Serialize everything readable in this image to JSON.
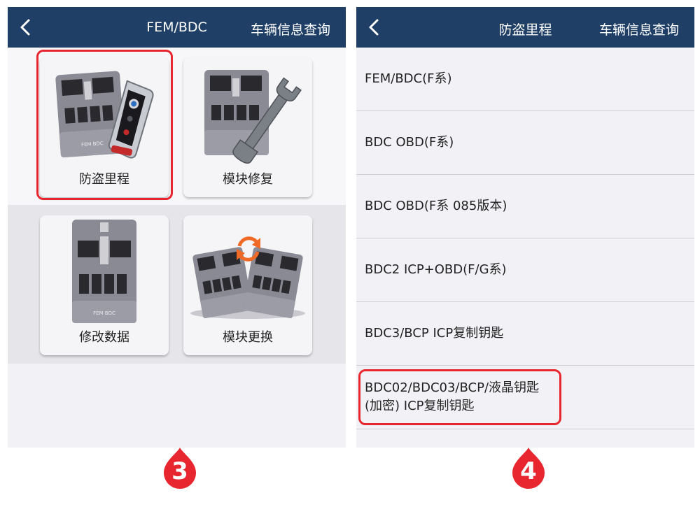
{
  "left_screen": {
    "nav": {
      "title": "FEM/BDC",
      "right": "车辆信息查询"
    },
    "tiles": [
      {
        "label": "防盗里程",
        "icon": "module-with-key-icon"
      },
      {
        "label": "模块修复",
        "icon": "module-with-wrench-icon"
      },
      {
        "label": "修改数据",
        "icon": "module-icon"
      },
      {
        "label": "模块更换",
        "icon": "module-swap-icon"
      }
    ],
    "module_print": "FEM BDC"
  },
  "right_screen": {
    "nav": {
      "title": "防盗里程",
      "right": "车辆信息查询"
    },
    "items": [
      "FEM/BDC(F系)",
      "BDC OBD(F系)",
      "BDC OBD(F系 085版本)",
      "BDC2 ICP+OBD(F/G系)",
      "BDC3/BCP ICP复制钥匙",
      "BDC02/BDC03/BCP/液晶钥匙\n(加密) ICP复制钥匙"
    ]
  },
  "steps": [
    "3",
    "4"
  ],
  "colors": {
    "nav_bg": "#1f3f66",
    "highlight": "#e8262f",
    "badge": "#e8262f",
    "swap_arrows": "#f06a25"
  }
}
